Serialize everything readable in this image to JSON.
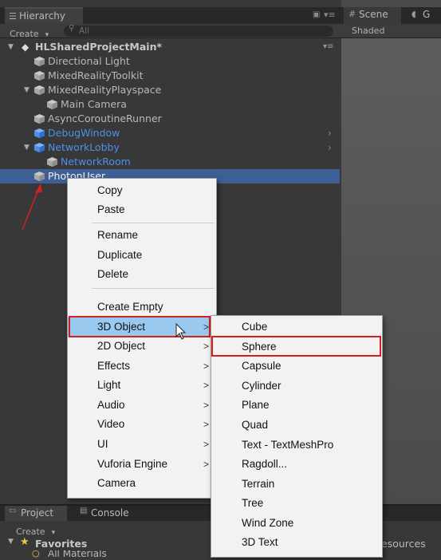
{
  "hierarchy": {
    "tab_label": "Hierarchy",
    "create_label": "Create",
    "search_placeholder": "All",
    "scene_name": "HLSharedProjectMain*",
    "items": [
      {
        "label": "Directional Light"
      },
      {
        "label": "MixedRealityToolkit"
      },
      {
        "label": "MixedRealityPlayspace"
      },
      {
        "label": "Main Camera"
      },
      {
        "label": "AsyncCoroutineRunner"
      },
      {
        "label": "DebugWindow"
      },
      {
        "label": "NetworkLobby"
      },
      {
        "label": "NetworkRoom"
      },
      {
        "label": "PhotonUser"
      }
    ]
  },
  "scene_panel": {
    "tab_label": "Scene",
    "game_tab_label": "G",
    "shading_label": "Shaded"
  },
  "bottom_panel": {
    "project_tab": "Project",
    "console_tab": "Console",
    "create_label": "Create",
    "favorites_label": "Favorites",
    "favorites_item": "All Materials",
    "resources_label": "esources"
  },
  "context_menu": {
    "items": [
      {
        "label": "Copy"
      },
      {
        "label": "Paste"
      },
      {
        "label": "Rename"
      },
      {
        "label": "Duplicate"
      },
      {
        "label": "Delete"
      },
      {
        "label": "Create Empty"
      },
      {
        "label": "3D Object"
      },
      {
        "label": "2D Object"
      },
      {
        "label": "Effects"
      },
      {
        "label": "Light"
      },
      {
        "label": "Audio"
      },
      {
        "label": "Video"
      },
      {
        "label": "UI"
      },
      {
        "label": "Vuforia Engine"
      },
      {
        "label": "Camera"
      }
    ]
  },
  "submenu_3d": {
    "items": [
      {
        "label": "Cube"
      },
      {
        "label": "Sphere"
      },
      {
        "label": "Capsule"
      },
      {
        "label": "Cylinder"
      },
      {
        "label": "Plane"
      },
      {
        "label": "Quad"
      },
      {
        "label": "Text - TextMeshPro"
      },
      {
        "label": "Ragdoll..."
      },
      {
        "label": "Terrain"
      },
      {
        "label": "Tree"
      },
      {
        "label": "Wind Zone"
      },
      {
        "label": "3D Text"
      }
    ]
  },
  "colors": {
    "selection": "#3e5f96",
    "highlight_box": "#d42020",
    "menu_hover": "#99c9ef",
    "prefab_blue": "#4f8fe8"
  }
}
